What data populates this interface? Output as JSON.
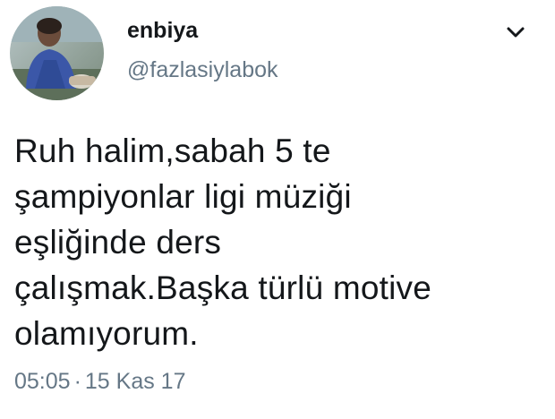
{
  "user": {
    "display_name": "enbiya",
    "username": "@fazlasiylabok"
  },
  "tweet": {
    "lines": [
      "Ruh halim,sabah 5 te",
      "şampiyonlar ligi müziği",
      "eşliğinde ders",
      "çalışmak.Başka türlü motive",
      "olamıyorum."
    ]
  },
  "meta": {
    "time": "05:05",
    "separator": "·",
    "date": "15 Kas 17"
  },
  "icons": {
    "menu": "chevron-down-icon"
  },
  "colors": {
    "text": "#14171a",
    "secondary": "#657786",
    "background": "#ffffff"
  }
}
